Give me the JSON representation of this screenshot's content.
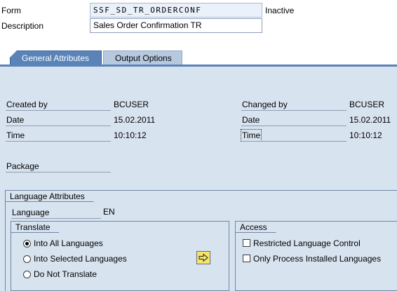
{
  "header": {
    "form_label": "Form",
    "form_value": "SSF_SD_TR_ORDERCONF",
    "form_status": "Inactive",
    "description_label": "Description",
    "description_value": "Sales Order Confirmation TR"
  },
  "tabs": [
    {
      "label": "General Attributes",
      "active": true
    },
    {
      "label": "Output Options",
      "active": false
    }
  ],
  "general": {
    "created_by_label": "Created by",
    "created_by_value": "BCUSER",
    "created_date_label": "Date",
    "created_date_value": "15.02.2011",
    "created_time_label": "Time",
    "created_time_value": "10:10:12",
    "changed_by_label": "Changed by",
    "changed_by_value": "BCUSER",
    "changed_date_label": "Date",
    "changed_date_value": "15.02.2011",
    "changed_time_label": "Time",
    "changed_time_value": "10:10:12",
    "package_label": "Package",
    "package_value": ""
  },
  "language": {
    "group_title": "Language Attributes",
    "language_label": "Language",
    "language_value": "EN",
    "translate": {
      "title": "Translate",
      "options": [
        {
          "label": "Into All Languages",
          "selected": true
        },
        {
          "label": "Into Selected Languages",
          "selected": false
        },
        {
          "label": "Do Not Translate",
          "selected": false
        }
      ],
      "select_button_icon": "arrow-right-icon"
    },
    "access": {
      "title": "Access",
      "options": [
        {
          "label": "Restricted Language Control",
          "checked": false
        },
        {
          "label": "Only Process Installed Languages",
          "checked": false
        }
      ]
    }
  },
  "colors": {
    "panel_bg": "#d8e3f0",
    "tab_active": "#5a83b7",
    "tab_inactive": "#b7c9df",
    "button_yellow": "#f4e46a"
  }
}
